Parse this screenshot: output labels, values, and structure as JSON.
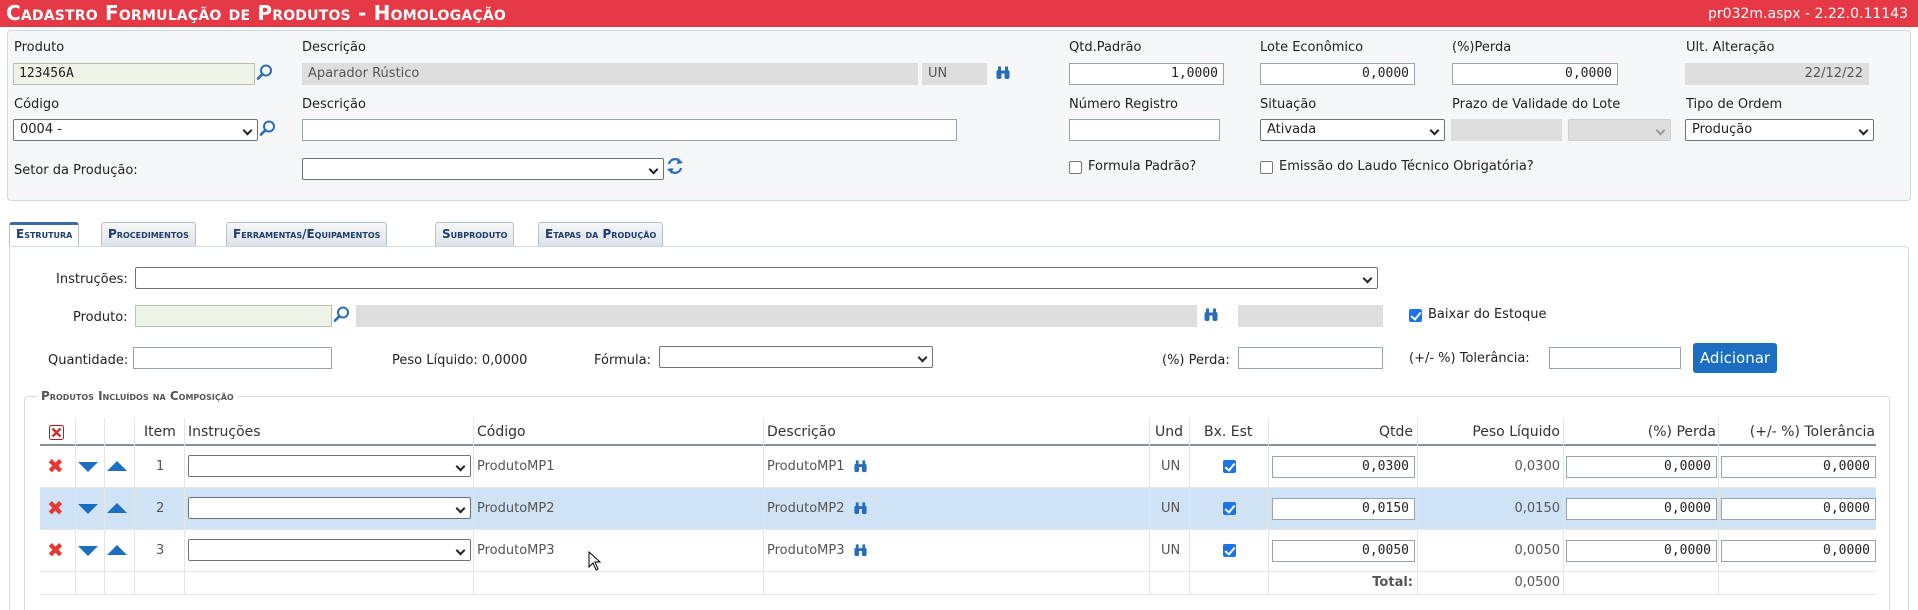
{
  "header": {
    "title": "Cadastro Formulação de Produtos  - Homologação",
    "version": "pr032m.aspx - 2.22.0.11143"
  },
  "form": {
    "produto": {
      "label": "Produto",
      "value": "123456A"
    },
    "descricao1": {
      "label": "Descrição",
      "value": "Aparador Rústico",
      "unit": "UN"
    },
    "qtd_padrao": {
      "label": "Qtd.Padrão",
      "value": "1,0000"
    },
    "lote_economico": {
      "label": "Lote Econômico",
      "value": "0,0000"
    },
    "perda": {
      "label": "(%)Perda",
      "value": "0,0000"
    },
    "ult_alteracao": {
      "label": "Ult. Alteração",
      "value": "22/12/22"
    },
    "codigo": {
      "label": "Código",
      "value": "0004 -"
    },
    "descricao2": {
      "label": "Descrição",
      "value": ""
    },
    "numero_registro": {
      "label": "Número Registro",
      "value": ""
    },
    "situacao": {
      "label": "Situação",
      "value": "Ativada"
    },
    "prazo_validade": {
      "label": "Prazo de Validade do Lote",
      "value": ""
    },
    "tipo_ordem": {
      "label": "Tipo de Ordem",
      "value": "Produção"
    },
    "setor_producao": {
      "label": "Setor da Produção:",
      "value": ""
    },
    "formula_padrao": {
      "label": "Formula Padrão?",
      "checked": false
    },
    "emissao_laudo": {
      "label": "Emissão do Laudo Técnico Obrigatória?",
      "checked": false
    }
  },
  "tabs": [
    {
      "label": "Estrutura",
      "active": true
    },
    {
      "label": "Procedimentos",
      "active": false
    },
    {
      "label": "Ferramentas/Equipamentos",
      "active": false
    },
    {
      "label": "Subproduto",
      "active": false
    },
    {
      "label": "Etapas da Produção",
      "active": false
    }
  ],
  "estrutura": {
    "instrucoes_label": "Instruções:",
    "produto_label": "Produto:",
    "baixar_estoque_label": "Baixar do Estoque",
    "baixar_estoque_checked": true,
    "quantidade_label": "Quantidade:",
    "peso_liquido_label": "Peso Líquido: 0,0000",
    "formula_label": "Fórmula:",
    "perda_label": "(%) Perda:",
    "tolerancia_label": "(+/- %) Tolerância:",
    "adicionar_label": "Adicionar"
  },
  "composicao": {
    "legend": "Produtos Incluídos na Composição",
    "columns": {
      "item": "Item",
      "instrucoes": "Instruções",
      "codigo": "Código",
      "descricao": "Descrição",
      "und": "Und",
      "bx_est": "Bx. Est",
      "qtde": "Qtde",
      "peso_liquido": "Peso Líquido",
      "perda": "(%) Perda",
      "tolerancia": "(+/- %) Tolerância"
    },
    "rows": [
      {
        "item": "1",
        "codigo": "ProdutoMP1",
        "descricao": "ProdutoMP1",
        "und": "UN",
        "bx_est": true,
        "qtde": "0,0300",
        "peso_liquido": "0,0300",
        "perda": "0,0000",
        "tolerancia": "0,0000",
        "highlighted": false
      },
      {
        "item": "2",
        "codigo": "ProdutoMP2",
        "descricao": "ProdutoMP2",
        "und": "UN",
        "bx_est": true,
        "qtde": "0,0150",
        "peso_liquido": "0,0150",
        "perda": "0,0000",
        "tolerancia": "0,0000",
        "highlighted": true
      },
      {
        "item": "3",
        "codigo": "ProdutoMP3",
        "descricao": "ProdutoMP3",
        "und": "UN",
        "bx_est": true,
        "qtde": "0,0050",
        "peso_liquido": "0,0050",
        "perda": "0,0000",
        "tolerancia": "0,0000",
        "highlighted": false
      }
    ],
    "total_label": "Total:",
    "total_value": "0,0500"
  },
  "colors": {
    "title_bar": "#e63946",
    "accent": "#1c6fc0",
    "row_highlight": "#cfe3f4",
    "delete_red": "#e53935"
  }
}
